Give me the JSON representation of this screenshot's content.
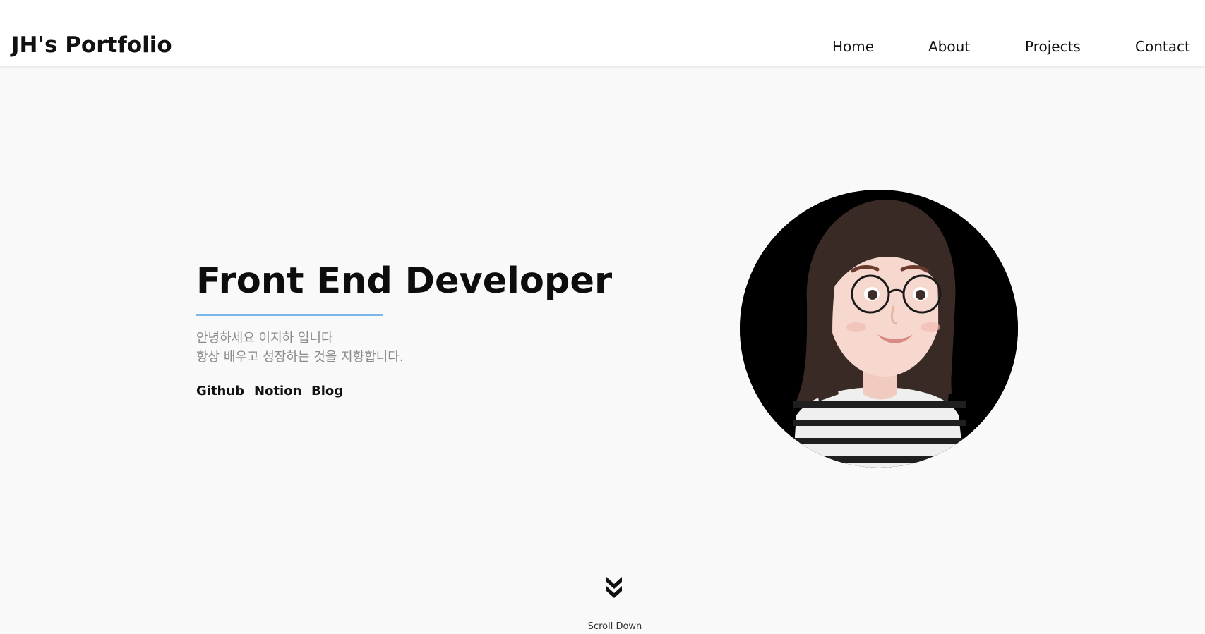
{
  "header": {
    "logo": "JH's Portfolio",
    "nav": [
      {
        "label": "Home"
      },
      {
        "label": "About"
      },
      {
        "label": "Projects"
      },
      {
        "label": "Contact"
      }
    ]
  },
  "hero": {
    "title": "Front End Developer",
    "intro": [
      "안녕하세요 이지하 입니다",
      "항상 배우고 성장하는 것을 지향합니다."
    ],
    "links": [
      {
        "label": "Github"
      },
      {
        "label": "Notion"
      },
      {
        "label": "Blog"
      }
    ],
    "avatar_icon": "avatar-illustration"
  },
  "scroll": {
    "icon": "double-chevron-down-icon",
    "label": "Scroll Down"
  },
  "colors": {
    "accent": "#7ab8ec",
    "background": "#f9f9f9",
    "header_bg": "#ffffff",
    "text": "#111111",
    "muted_text": "#8a8a8a"
  }
}
